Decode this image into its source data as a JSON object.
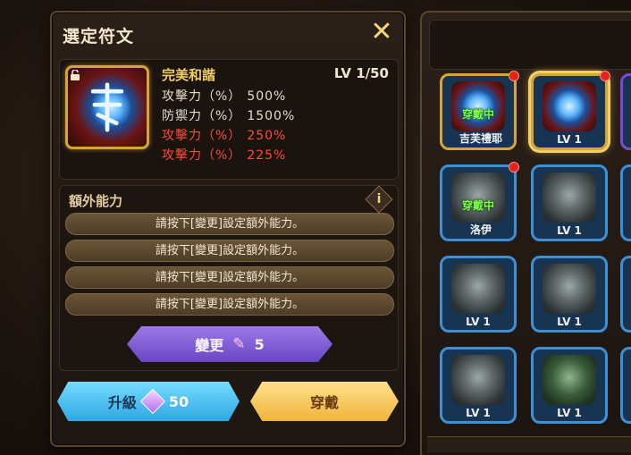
{
  "panel": {
    "title": "選定符文",
    "close_label": "✕"
  },
  "rune": {
    "name": "完美和諧",
    "level": "LV 1/50",
    "stats": [
      {
        "label": "攻擊力（%）",
        "value": "500%",
        "color": "normal"
      },
      {
        "label": "防禦力（%）",
        "value": "1500%",
        "color": "normal"
      },
      {
        "label": "攻擊力（%）",
        "value": "250%",
        "color": "red"
      },
      {
        "label": "攻擊力（%）",
        "value": "225%",
        "color": "red"
      }
    ]
  },
  "extra": {
    "title": "額外能力",
    "info_label": "i",
    "slots": [
      "請按下[變更]設定額外能力。",
      "請按下[變更]設定額外能力。",
      "請按下[變更]設定額外能力。",
      "請按下[變更]設定額外能力。"
    ]
  },
  "buttons": {
    "change_label": "變更",
    "change_cost": "5",
    "upgrade_label": "升級",
    "upgrade_cost": "50",
    "equip_label": "穿戴"
  },
  "inventory": {
    "items": [
      {
        "lv": "",
        "equipped": "穿戴中",
        "owner": "吉芙禮耶",
        "art": "blue",
        "frame": "gold",
        "dot": true,
        "selected": false
      },
      {
        "lv": "LV 1",
        "equipped": "",
        "owner": "",
        "art": "blue",
        "frame": "gold",
        "dot": true,
        "selected": true
      },
      {
        "lv": "",
        "equipped": "穿戴中",
        "owner": "洛伊",
        "art": "stone",
        "frame": "blue",
        "dot": true,
        "selected": false
      },
      {
        "lv": "LV 1",
        "equipped": "",
        "owner": "",
        "art": "stone",
        "frame": "blue",
        "dot": false,
        "selected": false
      },
      {
        "lv": "LV 1",
        "equipped": "",
        "owner": "",
        "art": "stone",
        "frame": "blue",
        "dot": false,
        "selected": false
      },
      {
        "lv": "LV 1",
        "equipped": "",
        "owner": "",
        "art": "stone",
        "frame": "blue",
        "dot": false,
        "selected": false
      },
      {
        "lv": "LV 1",
        "equipped": "",
        "owner": "",
        "art": "stone",
        "frame": "blue",
        "dot": false,
        "selected": false
      },
      {
        "lv": "LV 1",
        "equipped": "",
        "owner": "",
        "art": "green",
        "frame": "blue",
        "dot": false,
        "selected": false
      }
    ]
  }
}
